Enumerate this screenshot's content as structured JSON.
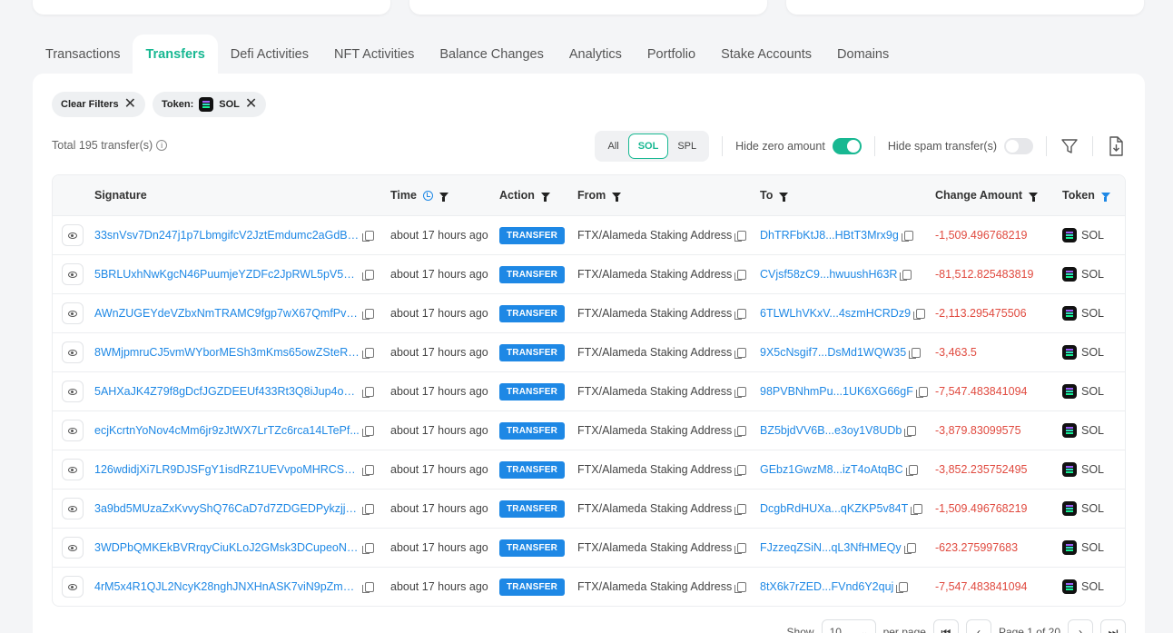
{
  "tabs": [
    {
      "label": "Transactions",
      "active": false
    },
    {
      "label": "Transfers",
      "active": true
    },
    {
      "label": "Defi Activities",
      "active": false
    },
    {
      "label": "NFT Activities",
      "active": false
    },
    {
      "label": "Balance Changes",
      "active": false
    },
    {
      "label": "Analytics",
      "active": false
    },
    {
      "label": "Portfolio",
      "active": false
    },
    {
      "label": "Stake Accounts",
      "active": false
    },
    {
      "label": "Domains",
      "active": false
    }
  ],
  "filters": {
    "clear_label": "Clear Filters",
    "token_label": "Token:",
    "token_value": "SOL"
  },
  "summary": {
    "total": "Total 195 transfer(s)"
  },
  "segment": {
    "all": "All",
    "sol": "SOL",
    "spl": "SPL",
    "selected": "SOL"
  },
  "toggles": {
    "hide_zero_label": "Hide zero amount",
    "hide_zero_on": true,
    "hide_spam_label": "Hide spam transfer(s)",
    "hide_spam_on": false
  },
  "table": {
    "headers": {
      "signature": "Signature",
      "time": "Time",
      "action": "Action",
      "from": "From",
      "to": "To",
      "amount": "Change Amount",
      "token": "Token"
    },
    "rows": [
      {
        "signature": "33snVsv7Dn247j1p7LbmgifcV2JztEmdumc2aGdBsi...",
        "time": "about 17 hours ago",
        "action": "TRANSFER",
        "from": "FTX/Alameda Staking Address",
        "to": "DhTRFbKtJ8...HBtT3Mrx9g",
        "amount": "-1,509.496768219",
        "token": "SOL"
      },
      {
        "signature": "5BRLUxhNwKgcN46PuumjeYZDFc2JpRWL5pV53gf...",
        "time": "about 17 hours ago",
        "action": "TRANSFER",
        "from": "FTX/Alameda Staking Address",
        "to": "CVjsf58zC9...hwuushH63R",
        "amount": "-81,512.825483819",
        "token": "SOL"
      },
      {
        "signature": "AWnZUGEYdeVZbxNmTRAMC9fgp7wX67QmfPvo7...",
        "time": "about 17 hours ago",
        "action": "TRANSFER",
        "from": "FTX/Alameda Staking Address",
        "to": "6TLWLhVKxV...4szmHCRDz9",
        "amount": "-2,113.295475506",
        "token": "SOL"
      },
      {
        "signature": "8WMjpmruCJ5vmWYborMESh3mKms65owZSteRZ...",
        "time": "about 17 hours ago",
        "action": "TRANSFER",
        "from": "FTX/Alameda Staking Address",
        "to": "9X5cNsgif7...DsMd1WQW35",
        "amount": "-3,463.5",
        "token": "SOL"
      },
      {
        "signature": "5AHXaJK4Z79f8gDcfJGZDEEUf433Rt3Q8iJup4owg...",
        "time": "about 17 hours ago",
        "action": "TRANSFER",
        "from": "FTX/Alameda Staking Address",
        "to": "98PVBNhmPu...1UK6XG66gF",
        "amount": "-7,547.483841094",
        "token": "SOL"
      },
      {
        "signature": "ecjKcrtnYoNov4cMm6jr9zJtWX7LrTZc6rca14LTePf...",
        "time": "about 17 hours ago",
        "action": "TRANSFER",
        "from": "FTX/Alameda Staking Address",
        "to": "BZ5bjdVV6B...e3oy1V8UDb",
        "amount": "-3,879.83099575",
        "token": "SOL"
      },
      {
        "signature": "126wdidjXi7LR9DJSFgY1isdRZ1UEVvpoMHRCSYCu...",
        "time": "about 17 hours ago",
        "action": "TRANSFER",
        "from": "FTX/Alameda Staking Address",
        "to": "GEbz1GwzM8...izT4oAtqBC",
        "amount": "-3,852.235752495",
        "token": "SOL"
      },
      {
        "signature": "3a9bd5MUzaZxKvvyShQ76CaD7d7ZDGEDPykzjjxj66...",
        "time": "about 17 hours ago",
        "action": "TRANSFER",
        "from": "FTX/Alameda Staking Address",
        "to": "DcgbRdHUXa...qKZKP5v84T",
        "amount": "-1,509.496768219",
        "token": "SOL"
      },
      {
        "signature": "3WDPbQMKEkBVRrqyCiuKLoJ2GMsk3DCupeoNgEi...",
        "time": "about 17 hours ago",
        "action": "TRANSFER",
        "from": "FTX/Alameda Staking Address",
        "to": "FJzzeqZSiN...qL3NfHMEQy",
        "amount": "-623.275997683",
        "token": "SOL"
      },
      {
        "signature": "4rM5x4R1QJL2NcyK28nghJNXHnASK7viN9pZmJq...",
        "time": "about 17 hours ago",
        "action": "TRANSFER",
        "from": "FTX/Alameda Staking Address",
        "to": "8tX6k7rZED...FVnd6Y2quj",
        "amount": "-7,547.483841094",
        "token": "SOL"
      }
    ]
  },
  "pagination": {
    "show_label": "Show",
    "page_size": "10",
    "per_page_label": "per page",
    "page_text": "Page 1 of 20"
  },
  "colors": {
    "accent": "#18b892",
    "link": "#1e88e5",
    "negative": "#e04a3f"
  }
}
